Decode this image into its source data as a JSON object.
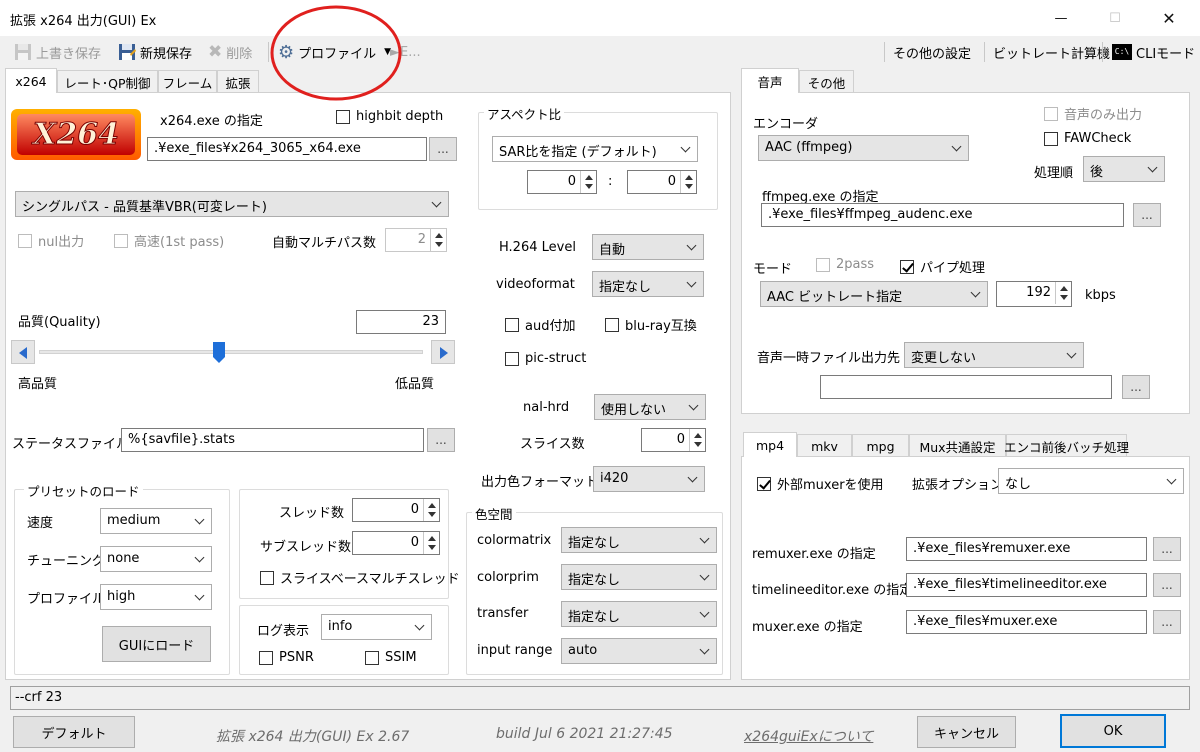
{
  "window": {
    "title": "拡張 x264 出力(GUI) Ex",
    "minimize": "—",
    "maximize": "☐",
    "close": "✕"
  },
  "toolbar": {
    "save": "上書き保存",
    "save_new": "新規保存",
    "delete": "削除",
    "profile": "プロファイル",
    "extra": "►E...",
    "other_settings": "その他の設定",
    "bitrate_calc": "ビットレート計算機",
    "cli_mode": "CLIモード",
    "cli_icon_text": "C:\\"
  },
  "left_tabs": [
    "x264",
    "レート･QP制御",
    "フレーム",
    "拡張"
  ],
  "x264": {
    "logo": "X264",
    "exe_label": "x264.exe の指定",
    "highbit_label": "highbit depth",
    "exe_path": ".¥exe_files¥x264_3065_x64.exe",
    "browse": "...",
    "mode": "シングルパス - 品質基準VBR(可変レート)",
    "nul_output": "nul出力",
    "fast_first": "高速(1st pass)",
    "auto_multipass": "自動マルチパス数",
    "auto_multipass_value": "2",
    "quality_label": "品質(Quality)",
    "quality_value": "23",
    "quality_fraction": 0.47,
    "high_quality": "高品質",
    "low_quality": "低品質",
    "status_label": "ステータスファイル",
    "status_value": "%{savfile}.stats",
    "preset_group": "プリセットのロード",
    "speed_label": "速度",
    "speed_value": "medium",
    "tuning_label": "チューニング",
    "tuning_value": "none",
    "profile_label": "プロファイル",
    "profile_value": "high",
    "load_button": "GUIにロード",
    "threads_label": "スレッド数",
    "threads_value": "0",
    "subthreads_label": "サブスレッド数",
    "subthreads_value": "0",
    "slice_mt": "スライスベースマルチスレッド",
    "log_label": "ログ表示",
    "log_value": "info",
    "psnr": "PSNR",
    "ssim": "SSIM",
    "aspect_group": "アスペクト比",
    "sar_mode": "SAR比を指定 (デフォルト)",
    "sar_x": "0",
    "sar_colon": ":",
    "sar_y": "0",
    "h264_level_label": "H.264 Level",
    "h264_level_value": "自動",
    "videoformat_label": "videoformat",
    "videoformat_value": "指定なし",
    "aud": "aud付加",
    "bluray": "blu-ray互換",
    "pic_struct": "pic-struct",
    "nal_hrd_label": "nal-hrd",
    "nal_hrd_value": "使用しない",
    "slices_label": "スライス数",
    "slices_value": "0",
    "out_color_label": "出力色フォーマット",
    "out_color_value": "i420",
    "colorspace_group": "色空間",
    "colormatrix_label": "colormatrix",
    "colormatrix_value": "指定なし",
    "colorprim_label": "colorprim",
    "colorprim_value": "指定なし",
    "transfer_label": "transfer",
    "transfer_value": "指定なし",
    "input_range_label": "input range",
    "input_range_value": "auto"
  },
  "audio_tabs": [
    "音声",
    "その他"
  ],
  "audio": {
    "encoder_label": "エンコーダ",
    "encoder_value": "AAC (ffmpeg)",
    "audio_only": "音声のみ出力",
    "fawcheck": "FAWCheck",
    "order_label": "処理順",
    "order_value": "後",
    "ffmpeg_label": "ffmpeg.exe の指定",
    "ffmpeg_path": ".¥exe_files¥ffmpeg_audenc.exe",
    "mode_label": "モード",
    "twopass": "2pass",
    "pipe": "パイプ処理",
    "bitrate_mode": "AAC ビットレート指定",
    "bitrate_value": "192",
    "kbps": "kbps",
    "temp_label": "音声一時ファイル出力先",
    "temp_value": "変更しない",
    "temp_path": ""
  },
  "mux_tabs": [
    "mp4",
    "mkv",
    "mpg",
    "Mux共通設定",
    "エンコ前後バッチ処理"
  ],
  "mux": {
    "use_external": "外部muxerを使用",
    "ext_option_label": "拡張オプション",
    "ext_option_value": "なし",
    "remuxer_label": "remuxer.exe の指定",
    "remuxer_path": ".¥exe_files¥remuxer.exe",
    "timeline_label": "timelineeditor.exe の指定",
    "timeline_path": ".¥exe_files¥timelineeditor.exe",
    "muxer_label": "muxer.exe の指定",
    "muxer_path": ".¥exe_files¥muxer.exe"
  },
  "cmdline": "--crf 23",
  "footer": {
    "default": "デフォルト",
    "version": "拡張 x264 出力(GUI) Ex 2.67",
    "build": "build Jul  6 2021 21:27:45",
    "about": "x264guiExについて",
    "cancel": "キャンセル",
    "ok": "OK"
  },
  "colors": {
    "annotation_circle": "#e0201e",
    "link": "#6d6d6d",
    "slider_thumb": "#1e6fd9"
  }
}
